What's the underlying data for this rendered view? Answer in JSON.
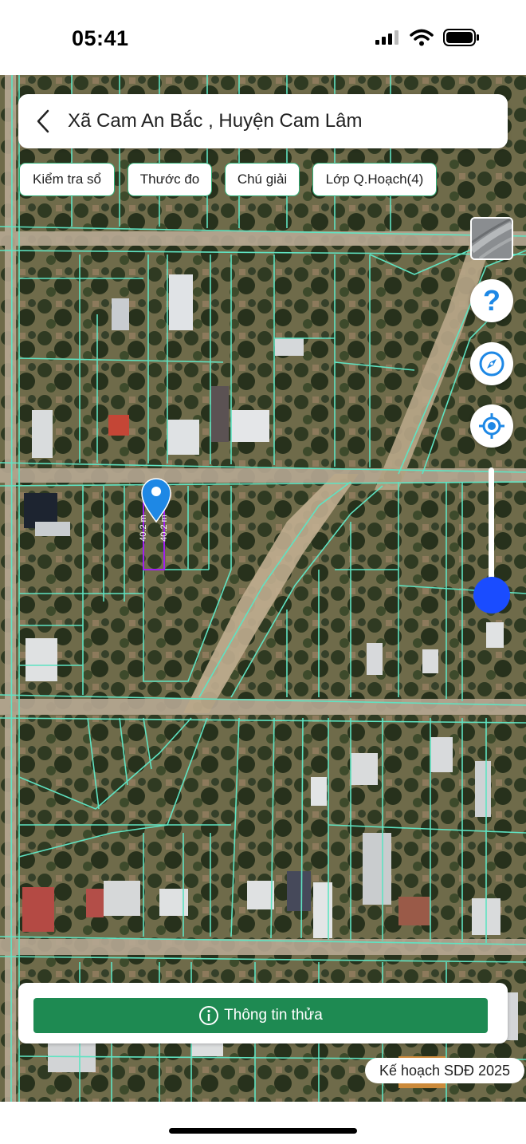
{
  "status_bar": {
    "time": "05:41"
  },
  "header": {
    "title": "Xã Cam An Bắc , Huyện Cam Lâm"
  },
  "chips": [
    {
      "label": "Kiểm tra sổ"
    },
    {
      "label": "Thước đo"
    },
    {
      "label": "Chú giải"
    },
    {
      "label": "Lớp Q.Hoạch(4)"
    }
  ],
  "map": {
    "parcel_measure_left": "40.2 m",
    "parcel_measure_right": "40.2 m",
    "boundary_color": "#5fe3c2",
    "selected_parcel_color": "#a020f0",
    "marker_color": "#1e88e5",
    "zoom_level": 0.12
  },
  "controls": {
    "help_icon": "help-icon",
    "compass_icon": "compass-icon",
    "locate_icon": "locate-icon"
  },
  "bottom": {
    "info_button_label": "Thông tin thửa",
    "plan_badge": "Kế hoạch SDĐ 2025"
  },
  "colors": {
    "accent_green": "#1e8a52",
    "chip_border": "#33b27a",
    "slider_blue": "#1a4cff"
  }
}
